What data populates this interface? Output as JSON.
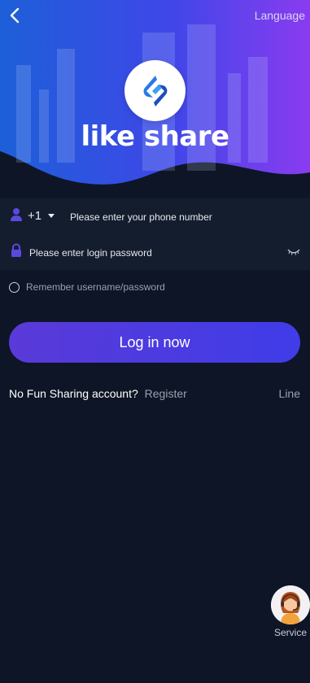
{
  "header": {
    "language_label": "Language",
    "brand_name": "like share",
    "icons": {
      "back": "chevron-left-icon",
      "logo": "like-share-logo"
    }
  },
  "form": {
    "country_code": "+1",
    "phone_placeholder": "Please enter your phone number",
    "password_placeholder": "Please enter login password",
    "remember_label": "Remember username/password",
    "login_button": "Log in now"
  },
  "footer": {
    "no_account_text": "No Fun Sharing account?",
    "register_link": "Register",
    "line_link": "Line"
  },
  "service": {
    "label": "Service"
  },
  "colors": {
    "background": "#0e1526",
    "field_bg": "#141d2e",
    "accent_start": "#5a3ad8",
    "accent_end": "#3f3ce8",
    "muted_text": "#9aa1ad"
  }
}
